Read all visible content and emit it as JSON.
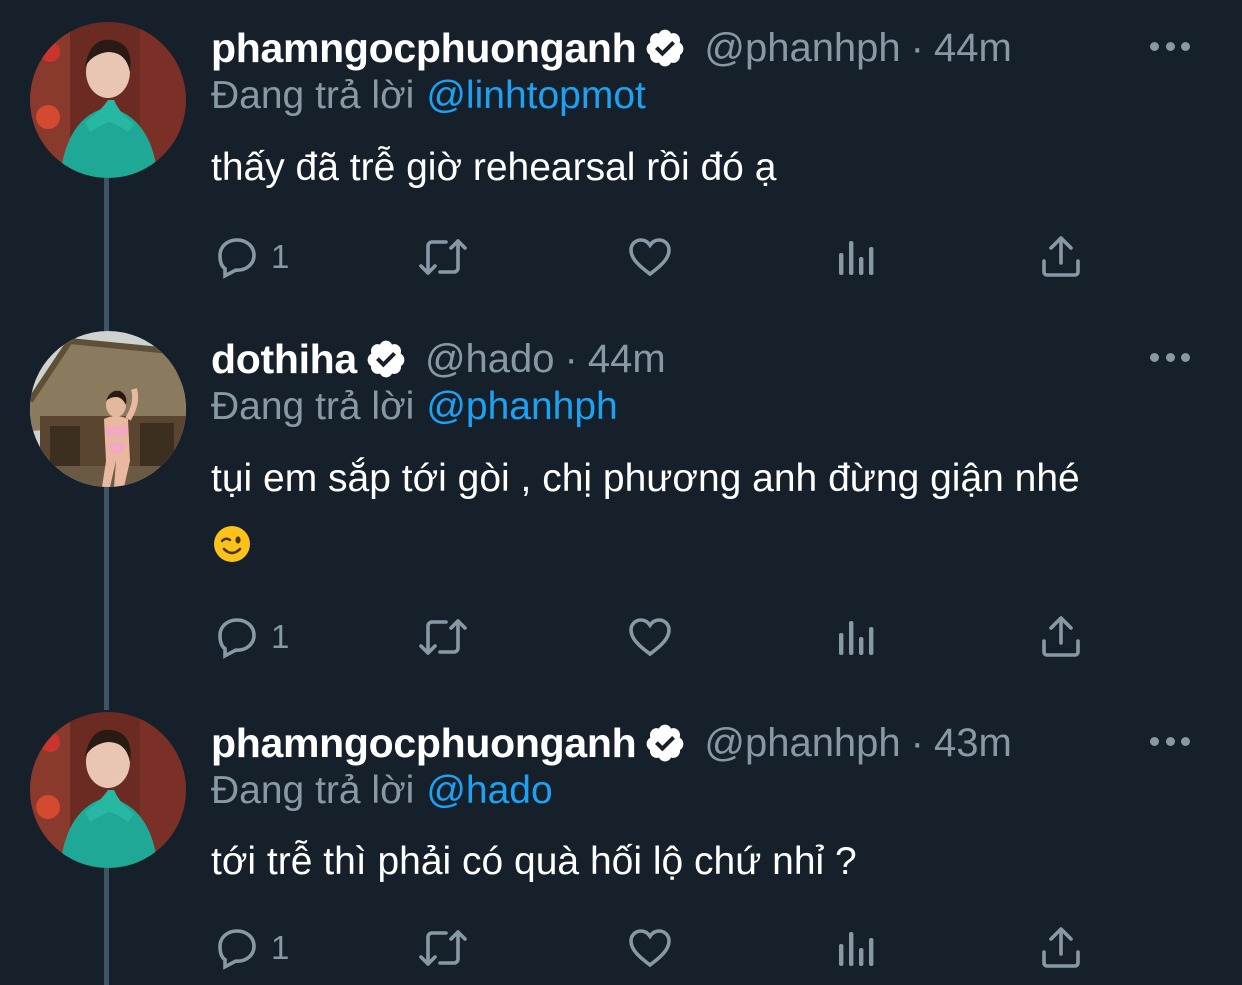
{
  "tweets": [
    {
      "name": "phamngocphuonganh",
      "handle": "@phanhph",
      "separator": "·",
      "time": "44m",
      "reply_prefix": "Đang trả lời",
      "reply_to": "@linhtopmot",
      "text_lines": [
        "thấy đã trễ giờ rehearsal rồi đó ạ"
      ],
      "emoji": "",
      "reply_count": "1",
      "avatar_icon": "avatar-woman-teal-dress",
      "verified": true
    },
    {
      "name": "dothiha",
      "handle": "@hado",
      "separator": "·",
      "time": "44m",
      "reply_prefix": "Đang trả lời",
      "reply_to": "@phanhph",
      "text_lines": [
        "tụi em sắp tới gòi , chị phương anh đừng giận nhé"
      ],
      "emoji": "winking-face-emoji",
      "reply_count": "1",
      "avatar_icon": "avatar-woman-hut-background",
      "verified": true
    },
    {
      "name": "phamngocphuonganh",
      "handle": "@phanhph",
      "separator": "·",
      "time": "43m",
      "reply_prefix": "Đang trả lời",
      "reply_to": "@hado",
      "text_lines": [
        "tới trễ thì phải có quà hối lộ chứ nhỉ ?"
      ],
      "emoji": "",
      "reply_count": "1",
      "avatar_icon": "avatar-woman-teal-dress",
      "verified": true
    }
  ],
  "colors": {
    "background": "#15202b",
    "primary_text": "#ffffff",
    "secondary_text": "#8899a6",
    "link": "#1da1f2",
    "thread_line": "#3d5466"
  }
}
